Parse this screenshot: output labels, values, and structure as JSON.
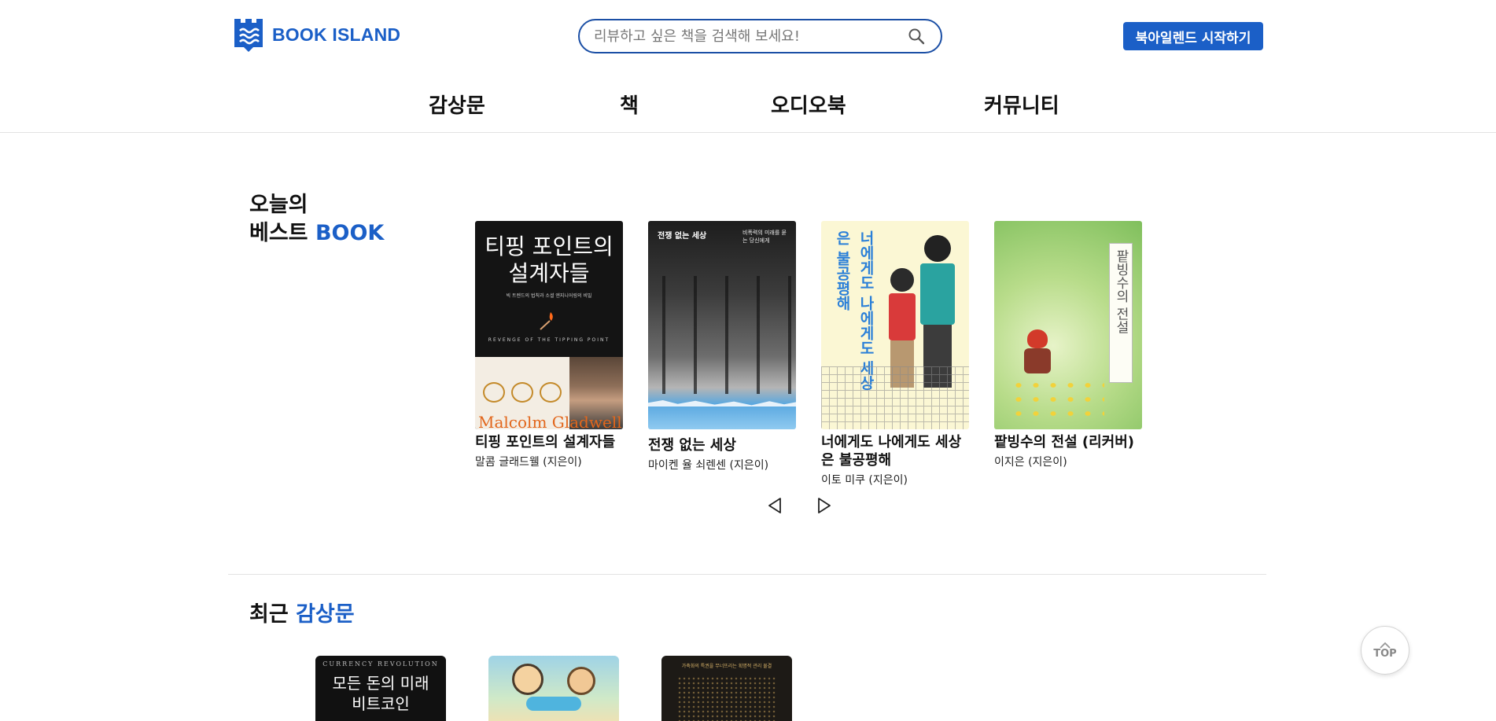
{
  "header": {
    "logo_text": "BOOK ISLAND",
    "search_placeholder": "리뷰하고 싶은 책을 검색해 보세요!",
    "start_button": "북아일렌드 시작하기",
    "nav": [
      "감상문",
      "책",
      "오디오북",
      "커뮤니티"
    ]
  },
  "best": {
    "title_line1": "오늘의",
    "title_line2_plain": "베스트",
    "title_line2_accent": "BOOK",
    "books": [
      {
        "title": "티핑 포인트의 설계자들",
        "author": "말콤 글래드웰 (지은이)",
        "cover_title": "티핑 포인트의 설계자들",
        "cover_sub": "빅 트렌드의 법칙과 소셜 엔지니어링의 비밀",
        "cover_en": "REVENGE OF THE TIPPING POINT",
        "cover_name": "Malcolm Gladwell"
      },
      {
        "title": "전쟁 없는 세상",
        "author": "마이켄 율 쇠렌센 (지은이)",
        "cover_title": "전쟁 없는 세상",
        "cover_sub": "비폭력의 미래를 묻는 당신에게"
      },
      {
        "title": "너에게도 나에게도 세상은 불공평해",
        "author": "이토 미쿠 (지은이)",
        "cover_title": "너에게도 나에게도 세상은 불공평해"
      },
      {
        "title": "팥빙수의 전설 (리커버)",
        "author": "이지은 (지은이)",
        "cover_title": "팥빙수의 전설"
      }
    ]
  },
  "recent": {
    "title_plain": "최근",
    "title_accent": "감상문",
    "covers": [
      {
        "top_text": "CURRENCY REVOLUTION",
        "title": "모든 돈의 미래 비트코인"
      },
      {
        "title": ""
      },
      {
        "top_text": "가축화의 특권을 무너뜨리는 획명적 관리 물결"
      }
    ]
  },
  "top_button": "TOP",
  "colors": {
    "brand": "#1b5fc7",
    "search_border": "#1b4fa5"
  }
}
